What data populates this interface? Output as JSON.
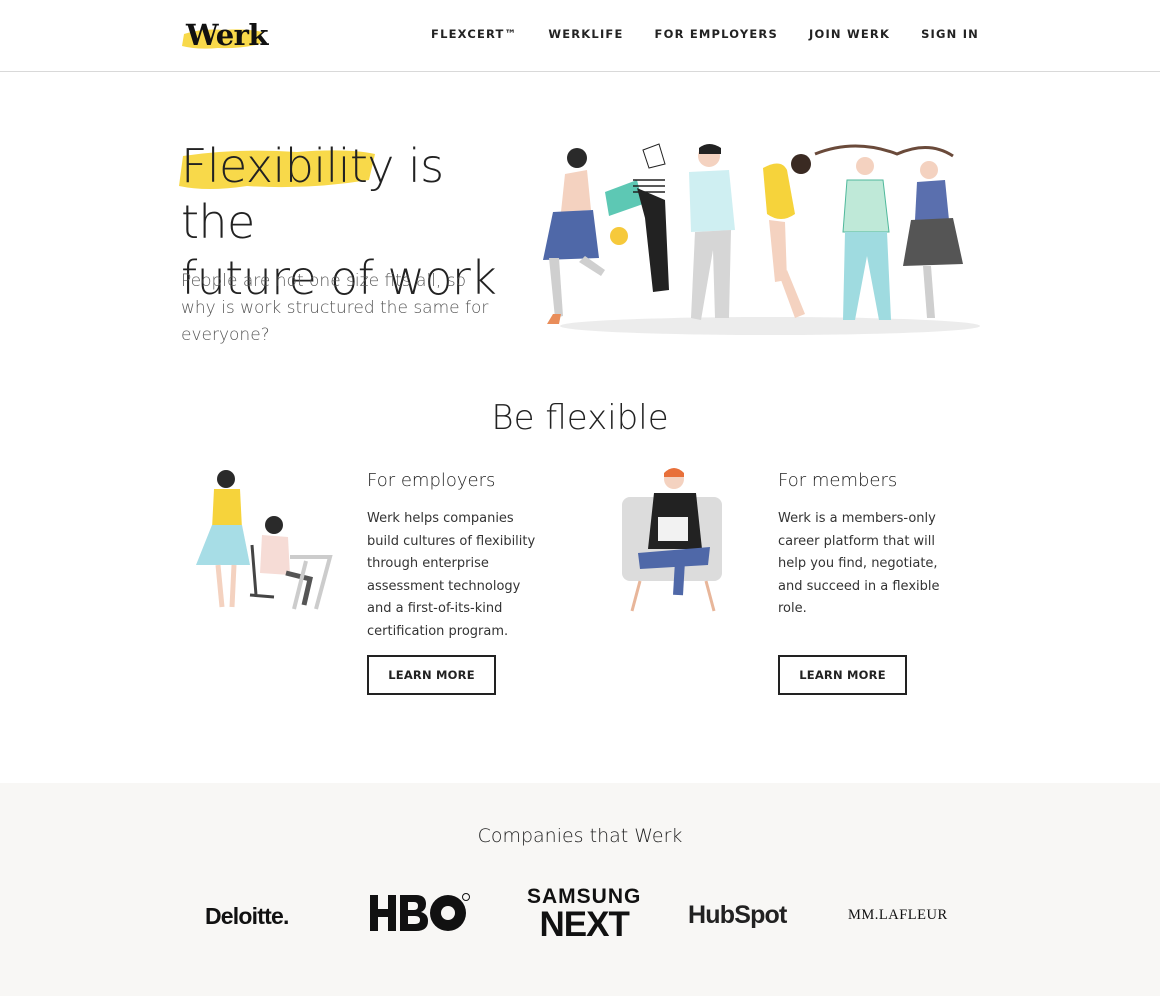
{
  "header": {
    "logo_text": "Werk",
    "nav": [
      "FLEXCERT™",
      "WERKLIFE",
      "FOR EMPLOYERS",
      "JOIN WERK",
      "SIGN IN"
    ]
  },
  "hero": {
    "title_highlight": "Flexibility",
    "title_rest_line1": " is the",
    "title_line2": "future of work",
    "subtitle": "People are not one size fits all, so why is work structured the same for everyone?"
  },
  "flexible": {
    "title": "Be flexible",
    "employers": {
      "heading": "For employers",
      "body": "Werk helps companies build cultures of flexibility through enterprise assessment technology and a first-of-its-kind certification program.",
      "button": "LEARN MORE"
    },
    "members": {
      "heading": "For members",
      "body": "Werk is a members-only career platform that will help you find, negotiate, and succeed in a flexible role.",
      "button": "LEARN MORE"
    }
  },
  "companies": {
    "title": "Companies that Werk",
    "logos": {
      "deloitte": "Deloitte.",
      "hbo": "HBO",
      "samsung_top": "SAMSUNG",
      "samsung_bottom": "NEXT",
      "hubspot": "HubSpot",
      "lafleur": "MM.LAFLEUR"
    }
  },
  "colors": {
    "accent_yellow": "#f8d94a",
    "text_dark": "#222222",
    "companies_bg": "#f8f7f5"
  }
}
